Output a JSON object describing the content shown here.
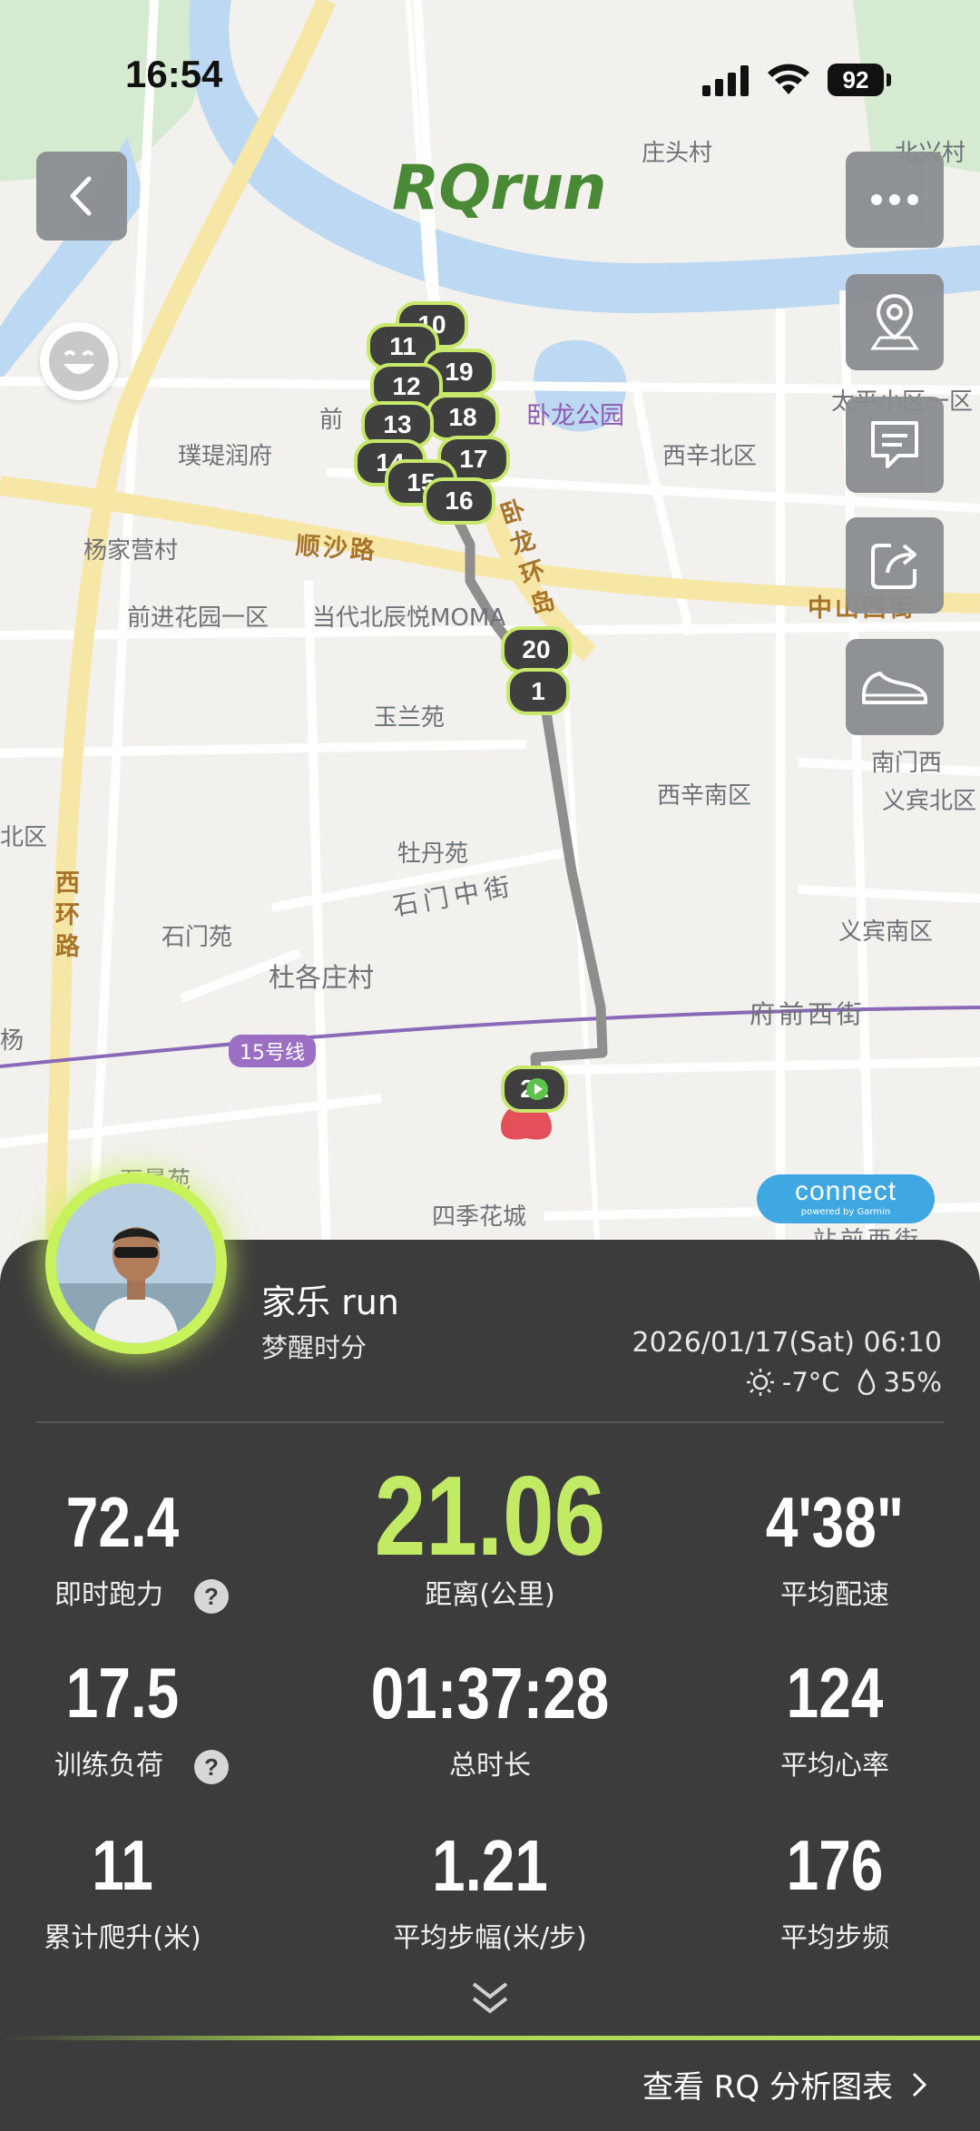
{
  "status_bar": {
    "time": "16:54",
    "battery": "92"
  },
  "brand": "RQrun",
  "map": {
    "places": {
      "zhuangtou": "庄头村",
      "beixing": "北兴村",
      "wolong_park": "卧龙公园",
      "taiping": "太平小区一区",
      "qian": "前",
      "pudi": "璞瑅润府",
      "xixin_bei": "西辛北区",
      "yangjiaying": "杨家营村",
      "shunsha": "顺沙路",
      "wolonghuan": "卧龙环岛",
      "zhongshan": "中山西街",
      "qianjin": "前进花园一区",
      "moma": "当代北辰悦MOMA",
      "yulan": "玉兰苑",
      "nanmen": "南门西",
      "yibin_bei": "义宾北区",
      "xixin_nan": "西辛南区",
      "bei": "北区",
      "mudan": "牡丹苑",
      "shimen_zhong": "石门中街",
      "xihuan": "西环路",
      "shimen": "石门苑",
      "yibin_nan": "义宾南区",
      "dugezhuang": "杜各庄村",
      "fuqian": "府前西街",
      "yang": "杨",
      "line15": "15号线",
      "shijing": "石景苑",
      "siji": "四季花城",
      "zhanqian": "站前西街"
    },
    "km_markers": [
      "10",
      "11",
      "19",
      "12",
      "18",
      "13",
      "17",
      "14",
      "15",
      "16",
      "20",
      "1",
      "21"
    ],
    "connect_label": "connect",
    "connect_sub": "powered by Garmin"
  },
  "buttons": {
    "back": "back",
    "more": "more",
    "location": "location",
    "comment": "comment",
    "share": "share",
    "shoe": "shoe"
  },
  "profile": {
    "name": "家乐 run",
    "subtitle": "梦醒时分",
    "datetime": "2026/01/17(Sat) 06:10",
    "temperature": "-7°C",
    "humidity": "35%"
  },
  "stats": {
    "running_power": {
      "value": "72.4",
      "label": "即时跑力"
    },
    "distance": {
      "value": "21.06",
      "label": "距离(公里)"
    },
    "avg_pace": {
      "value": "4'38\"",
      "label": "平均配速"
    },
    "training_load": {
      "value": "17.5",
      "label": "训练负荷"
    },
    "duration": {
      "value": "01:37:28",
      "label": "总时长"
    },
    "avg_hr": {
      "value": "124",
      "label": "平均心率"
    },
    "elevation": {
      "value": "11",
      "label": "累计爬升(米)"
    },
    "stride": {
      "value": "1.21",
      "label": "平均步幅(米/步)"
    },
    "cadence": {
      "value": "176",
      "label": "平均步频"
    }
  },
  "help_icon": "?",
  "footer": {
    "link": "查看 RQ 分析图表"
  },
  "colors": {
    "accent": "#b8e05a",
    "panel": "#3c3c3c",
    "brand_green": "#4a8a36",
    "route": "#8e8e8e"
  }
}
